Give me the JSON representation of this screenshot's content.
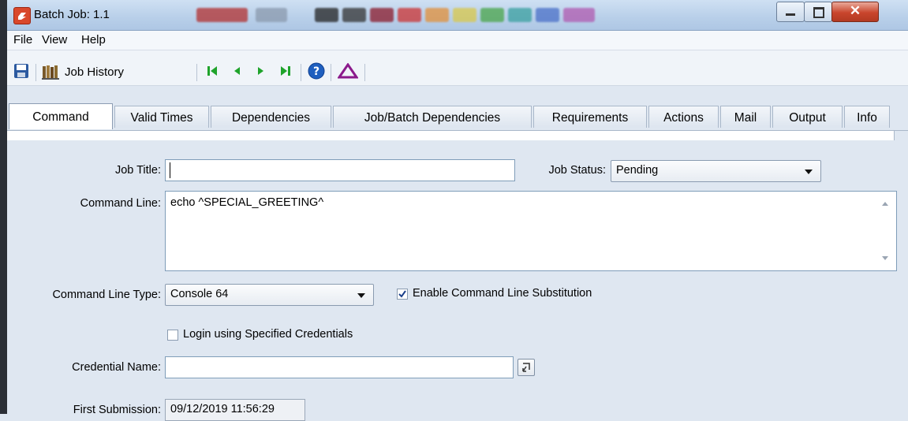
{
  "window": {
    "title": "Batch Job: 1.1",
    "controls": {
      "minimize": "minimize-icon",
      "maximize": "maximize-icon",
      "close": "✕"
    }
  },
  "menu": [
    "File",
    "View",
    "Help"
  ],
  "toolbar": {
    "history_label": "Job History",
    "icons": [
      "save-icon",
      "job-history-icon",
      "first-icon",
      "previous-icon",
      "next-icon",
      "last-icon",
      "help-icon",
      "alert-icon"
    ]
  },
  "tabs": [
    {
      "label": "Command",
      "active": true
    },
    {
      "label": "Valid Times"
    },
    {
      "label": "Dependencies"
    },
    {
      "label": "Job/Batch Dependencies"
    },
    {
      "label": "Requirements"
    },
    {
      "label": "Actions"
    },
    {
      "label": "Mail"
    },
    {
      "label": "Output"
    },
    {
      "label": "Info"
    }
  ],
  "form": {
    "job_title_label": "Job Title:",
    "job_title_value": "",
    "job_status_label": "Job Status:",
    "job_status_value": "Pending",
    "command_line_label": "Command Line:",
    "command_line_value": "echo ^SPECIAL_GREETING^",
    "command_line_type_label": "Command Line Type:",
    "command_line_type_value": "Console 64",
    "enable_substitution_label": "Enable Command Line Substitution",
    "enable_substitution_checked": true,
    "login_credentials_label": "Login using Specified Credentials",
    "login_credentials_checked": false,
    "credential_name_label": "Credential Name:",
    "credential_name_value": "",
    "first_submission_label": "First Submission:",
    "first_submission_value": "09/12/2019 11:56:29"
  },
  "colors": {
    "titlebar": "#b8cfe9",
    "close_button": "#c9452c",
    "panel_background": "#dfe7f1",
    "nav_green": "#1fa32b",
    "alert_purple": "#8b1a8b",
    "help_blue": "#1f5fbf"
  }
}
